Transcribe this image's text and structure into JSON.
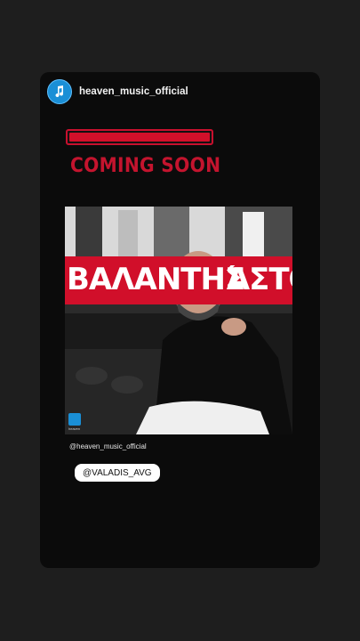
{
  "account": {
    "username": "heaven_music_official"
  },
  "story": {
    "progress": 1.0,
    "heading": "COMING SOON",
    "poster": {
      "title_left": "ΒΑΛΑΝΤΗΣ",
      "title_right": "ΆΣΤΟ",
      "label_logo": "heaven"
    },
    "caption": "@heaven_music_official",
    "mention": "@VALADIS_AVG"
  },
  "colors": {
    "accent": "#c8102e",
    "avatar": "#1a8fd6"
  }
}
